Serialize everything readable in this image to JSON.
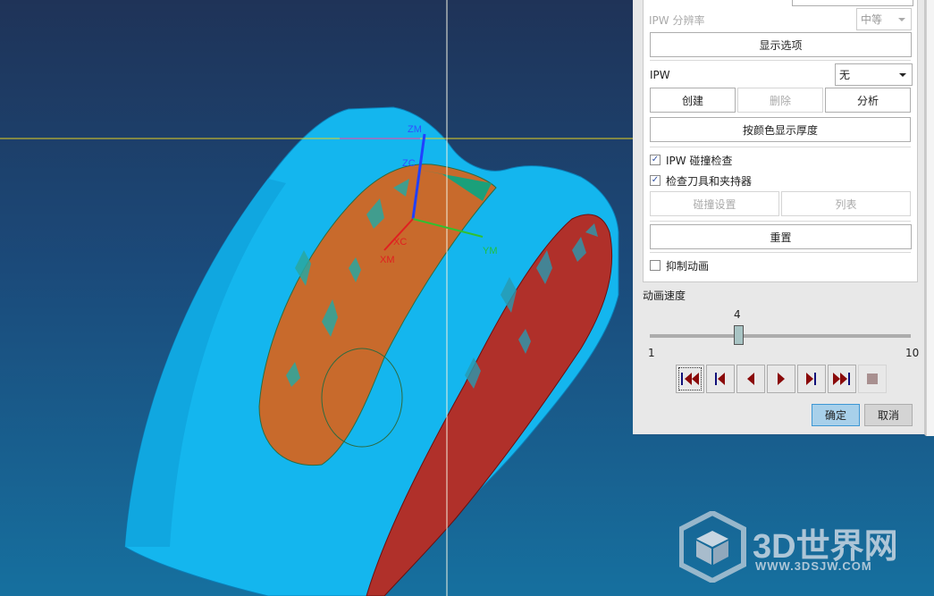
{
  "viewport": {
    "axes": {
      "zm": "ZM",
      "xm": "XM",
      "ym": "YM",
      "xc": "XC",
      "zc": "ZC"
    }
  },
  "panel": {
    "ipw_resolution_label": "IPW 分辨率",
    "ipw_resolution_value": "中等",
    "display_options": "显示选项",
    "ipw_label": "IPW",
    "ipw_value": "无",
    "create": "创建",
    "delete": "删除",
    "analyze": "分析",
    "show_thickness_by_color": "按颜色显示厚度",
    "ipw_collision_check": {
      "label": "IPW 碰撞检查",
      "checked": true
    },
    "check_tool_holder": {
      "label": "检查刀具和夹持器",
      "checked": true
    },
    "collision_settings": "碰撞设置",
    "list": "列表",
    "reset": "重置",
    "suppress_animation": {
      "label": "抑制动画",
      "checked": false
    },
    "animation_speed_label": "动画速度",
    "speed": {
      "value": "4",
      "min": "1",
      "max": "10"
    },
    "ok": "确定",
    "cancel": "取消"
  },
  "watermark": {
    "title": "3D世界网",
    "url": "WWW.3DSJW.COM"
  }
}
